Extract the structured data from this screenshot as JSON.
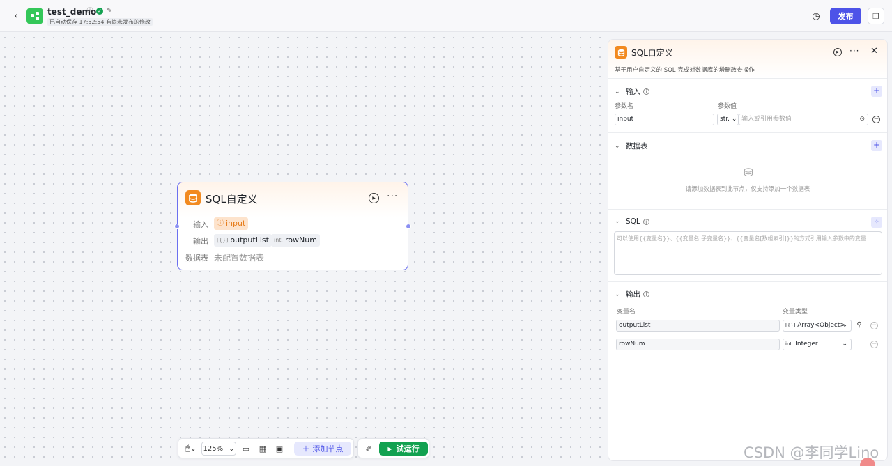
{
  "header": {
    "app_title": "test_demo",
    "autosave": "已自动保存 17:52:54",
    "unpublished": "有尚未发布的修改",
    "publish_label": "发布"
  },
  "node": {
    "title": "SQL自定义",
    "input_label": "输入",
    "input_chip": "input",
    "output_label": "输出",
    "output_chips": [
      {
        "type_icon": "[{}]",
        "name": "outputList"
      },
      {
        "type_icon": "int.",
        "name": "rowNum"
      }
    ],
    "db_label": "数据表",
    "db_empty": "未配置数据表"
  },
  "toolbar": {
    "zoom": "125%",
    "add_node": "添加节点",
    "run": "试运行"
  },
  "panel": {
    "title": "SQL自定义",
    "description": "基于用户自定义的 SQL 完成对数据库的增删改查操作",
    "input_section": {
      "title": "输入",
      "col_name": "参数名",
      "col_value": "参数值",
      "param_name": "input",
      "param_type": "str.",
      "param_value_placeholder": "输入或引用参数值"
    },
    "db_section": {
      "title": "数据表",
      "empty_text": "请添加数据表到此节点，仅支持添加一个数据表"
    },
    "sql_section": {
      "title": "SQL",
      "placeholder": "可以使用{{变量名}}、{{变量名.子变量名}}、{{变量名[数组索引]}}的方式引用输入参数中的变量"
    },
    "output_section": {
      "title": "输出",
      "col_name": "变量名",
      "col_type": "变量类型",
      "rows": [
        {
          "name": "outputList",
          "type_icon": "[{}]",
          "type": "Array<Object>"
        },
        {
          "name": "rowNum",
          "type_icon": "int.",
          "type": "Integer"
        }
      ]
    }
  },
  "watermark": "CSDN @李同学Lino",
  "colors": {
    "brand": "#4d53e8",
    "run_green": "#12a150",
    "node_orange": "#f28a20"
  }
}
